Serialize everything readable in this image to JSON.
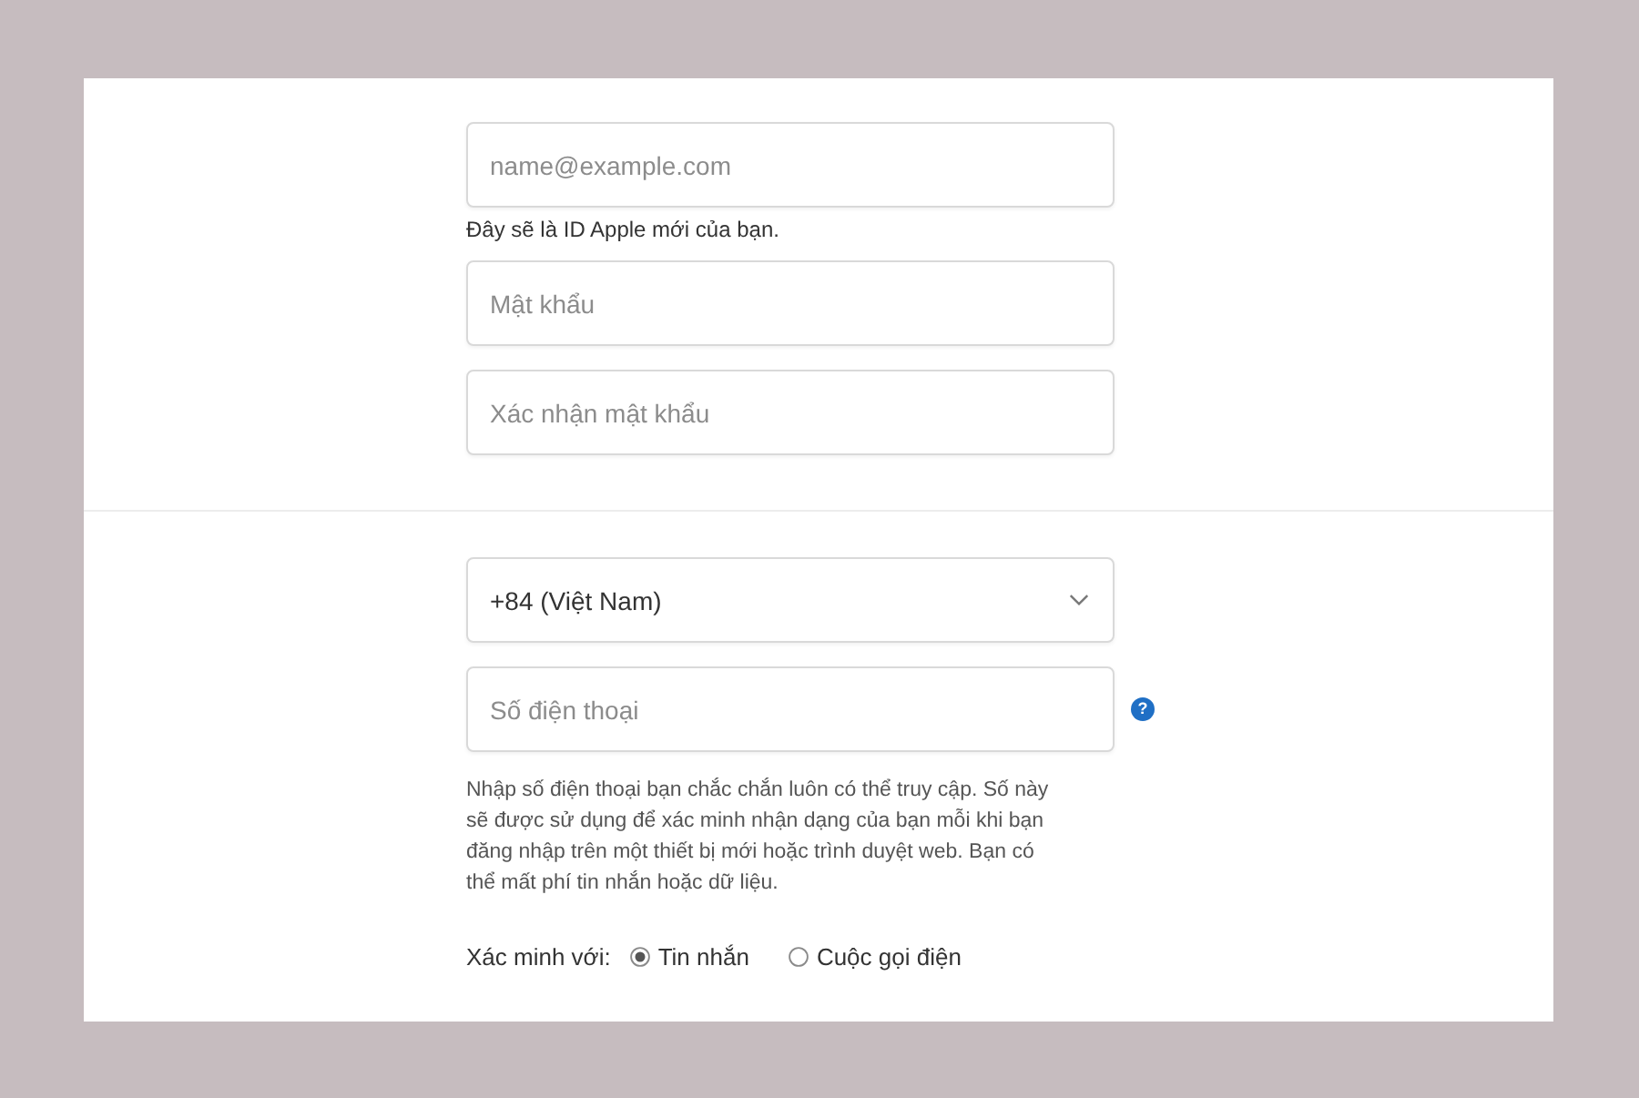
{
  "account": {
    "email": {
      "placeholder": "name@example.com",
      "hint": "Đây sẽ là ID Apple mới của bạn."
    },
    "password": {
      "placeholder": "Mật khẩu"
    },
    "confirm_password": {
      "placeholder": "Xác nhận mật khẩu"
    }
  },
  "phone": {
    "country": {
      "value": "+84 (Việt Nam)"
    },
    "number": {
      "placeholder": "Số điện thoại"
    },
    "help_button": "?",
    "description": "Nhập số điện thoại bạn chắc chắn luôn có thể truy cập. Số này sẽ được sử dụng để xác minh nhận dạng của bạn mỗi khi bạn đăng nhập trên một thiết bị mới hoặc trình duyệt web. Bạn có thể mất phí tin nhắn hoặc dữ liệu.",
    "verify": {
      "label": "Xác minh với:",
      "options": [
        {
          "label": "Tin nhắn",
          "selected": true
        },
        {
          "label": "Cuộc gọi điện",
          "selected": false
        }
      ]
    }
  }
}
